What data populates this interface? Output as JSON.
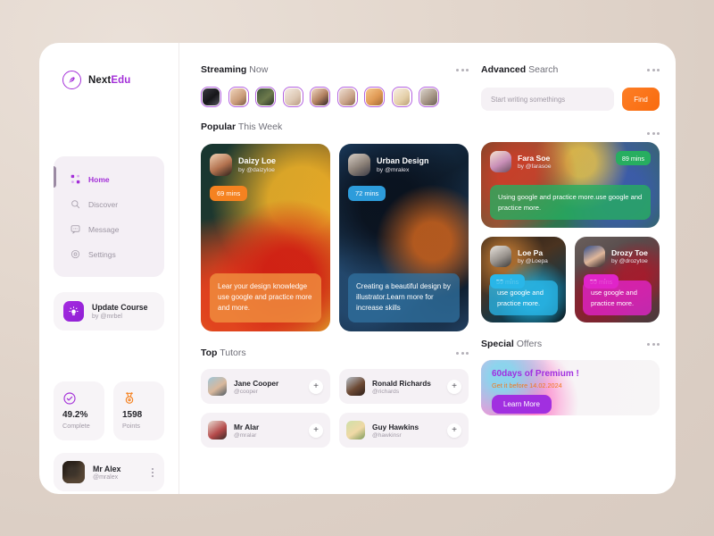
{
  "brand": {
    "name_first": "Next",
    "name_second": "Edu",
    "icon": "feather-icon"
  },
  "sidebar": {
    "nav": [
      {
        "label": "Home",
        "icon": "grid-icon",
        "active": true
      },
      {
        "label": "Discover",
        "icon": "search-icon",
        "active": false
      },
      {
        "label": "Message",
        "icon": "message-icon",
        "active": false
      },
      {
        "label": "Settings",
        "icon": "gear-icon",
        "active": false
      }
    ],
    "update_card": {
      "title": "Update Course",
      "subtitle": "by @mrbel",
      "icon": "lightbulb-icon"
    },
    "stats": [
      {
        "value": "49.2%",
        "label": "Complete",
        "icon": "check-circle-icon",
        "color": "#a32fd8"
      },
      {
        "value": "1598",
        "label": "Points",
        "icon": "medal-icon",
        "color": "#f58220"
      }
    ],
    "user": {
      "name": "Mr Alex",
      "handle": "@mralex"
    }
  },
  "streaming": {
    "title_bold": "Streaming",
    "title_rest": "Now",
    "avatars": [
      "stream-1",
      "stream-2",
      "stream-3",
      "stream-4",
      "stream-5",
      "stream-6",
      "stream-7",
      "stream-8",
      "stream-9"
    ]
  },
  "search": {
    "title_bold": "Advanced",
    "title_rest": "Search",
    "placeholder": "Start writing somethings",
    "value": "",
    "button": "Find",
    "button_color": "#f96b0e"
  },
  "popular": {
    "title_bold": "Popular",
    "title_rest": "This Week",
    "cards": [
      {
        "name": "Daizy Loe",
        "by": "by @daizyloe",
        "duration": "69 mins",
        "badge_color": "#f58220",
        "caption": "Lear your design knowledge use google and practice more and more.",
        "caption_color": "#ef8a3c"
      },
      {
        "name": "Urban Design",
        "by": "by @mralex",
        "duration": "72 mins",
        "badge_color": "#2d9cdb",
        "caption": "Creating a beautiful design by illustrator.Learn more for increase skills",
        "caption_color": "#2f6f9e"
      }
    ]
  },
  "featured": {
    "wide": {
      "name": "Fara Soe",
      "by": "by @farasoe",
      "duration": "89 mins",
      "badge_color": "#27ae60",
      "caption": "Using google and practice more.use google and practice more.",
      "caption_color": "#27ae60"
    },
    "small": [
      {
        "name": "Loe Pa",
        "by": "by @Loepa",
        "duration": "59 mins",
        "badge_color": "#29b6e8",
        "caption": "use google and practice more.",
        "caption_color": "#29b6e8"
      },
      {
        "name": "Drozy Toe",
        "by": "by @drozytoe",
        "duration": "59 mins",
        "badge_color": "#e024c9",
        "caption": "use google and practice more.",
        "caption_color": "#e024c9"
      }
    ]
  },
  "tutors": {
    "title_bold": "Top",
    "title_rest": "Tutors",
    "add_label": "+",
    "items": [
      {
        "name": "Jane Cooper",
        "handle": "@cooper"
      },
      {
        "name": "Ronald Richards",
        "handle": "@richards"
      },
      {
        "name": "Mr Alar",
        "handle": "@mralar"
      },
      {
        "name": "Guy Hawkins",
        "handle": "@hawkinsr"
      }
    ]
  },
  "offers": {
    "title_bold": "Special",
    "title_rest": "Offers",
    "headline": "60days of Premium !",
    "subline": "Get it before 14.02.2024",
    "button": "Learn More",
    "headline_color": "#a12fe0",
    "subline_color": "#f2781d"
  }
}
